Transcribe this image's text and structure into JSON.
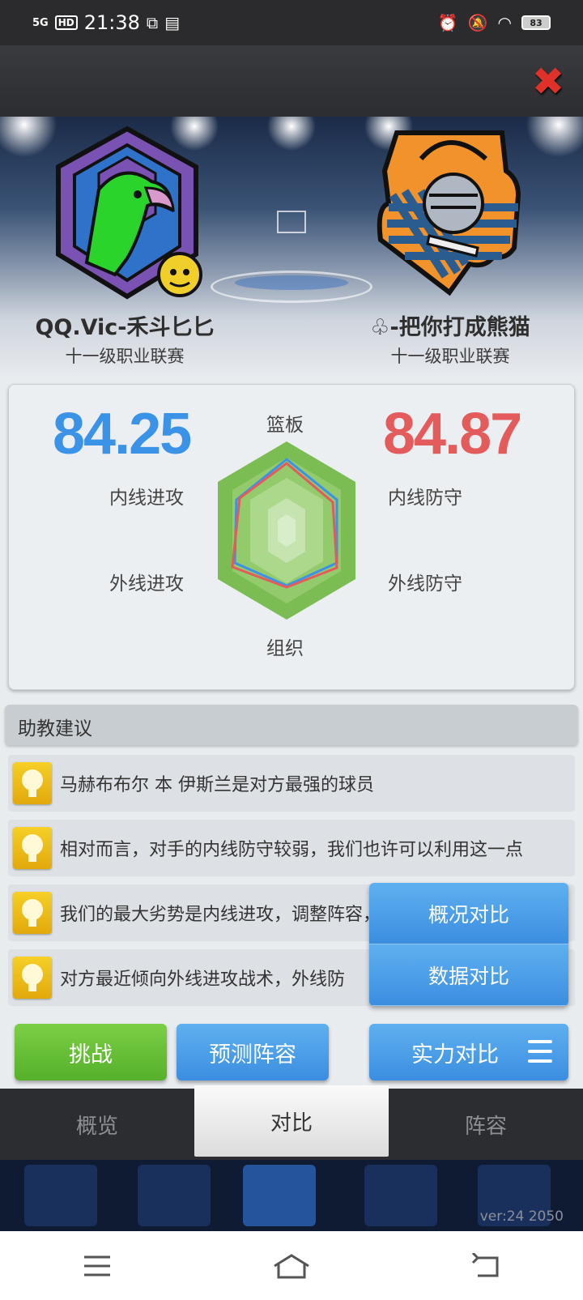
{
  "status_bar": {
    "signal": "5G",
    "hd": "HD",
    "time": "21:38",
    "battery": "83"
  },
  "header": {
    "close_icon": "close-x-icon"
  },
  "teams": {
    "left": {
      "name": "QQ.Vic-禾斗匕匕",
      "league": "十一级职业联赛",
      "logo": "eagle-logo"
    },
    "right": {
      "name": "♧-把你打成熊猫",
      "league": "十一级职业联赛",
      "logo": "knight-logo"
    }
  },
  "comparison": {
    "left_score": "84.25",
    "right_score": "84.87",
    "left_color": "#3a93e6",
    "right_color": "#e45b5b",
    "labels": {
      "top": "篮板",
      "upper_left": "内线进攻",
      "upper_right": "内线防守",
      "lower_left": "外线进攻",
      "lower_right": "外线防守",
      "bottom": "组织"
    }
  },
  "advice": {
    "title": "助教建议",
    "tips": [
      "马赫布布尔 本 伊斯兰是对方最强的球员",
      "相对而言，对手的内线防守较弱，我们也许可以利用这一点",
      "我们的最大劣势是内线进攻，调整阵容，",
      "对方最近倾向外线进攻战术，外线防"
    ]
  },
  "buttons": {
    "challenge": "挑战",
    "predict": "预测阵容",
    "strength": "实力对比"
  },
  "popup_menu": {
    "items": [
      "概况对比",
      "数据对比"
    ]
  },
  "tabs": [
    "概览",
    "对比",
    "阵容"
  ],
  "active_tab": "对比",
  "version": "ver:24  2050"
}
